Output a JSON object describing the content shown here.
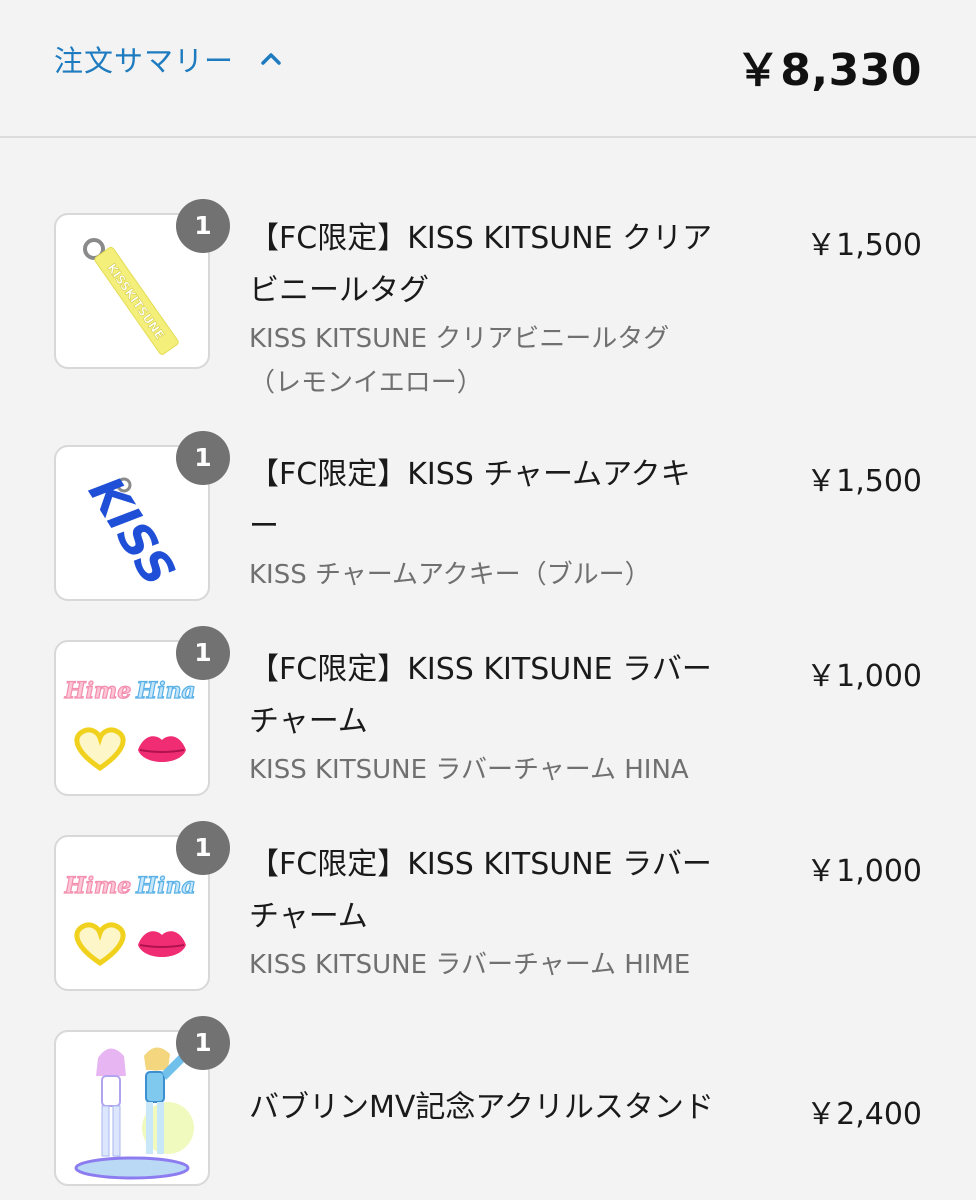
{
  "header": {
    "summary_label": "注文サマリー",
    "total": "￥8,330"
  },
  "items": [
    {
      "quantity": "1",
      "title_line1": "【FC限定】KISS KITSUNE クリア",
      "title_line2": "ビニールタグ",
      "variant_line1": "KISS KITSUNE クリアビニールタグ",
      "variant_line2": "（レモンイエロー）",
      "price": "￥1,500",
      "image_text": "KISSKITSUNE"
    },
    {
      "quantity": "1",
      "title_line1": "【FC限定】KISS チャームアクキ",
      "title_line2": "ー",
      "variant_line1": "KISS チャームアクキー（ブルー）",
      "price": "￥1,500",
      "image_text": "KISS"
    },
    {
      "quantity": "1",
      "title_line1": "【FC限定】KISS KITSUNE ラバー",
      "title_line2": "チャーム",
      "variant_line1": "KISS KITSUNE ラバーチャーム HINA",
      "price": "￥1,000",
      "image_text_1": "Hime",
      "image_text_2": "Hina"
    },
    {
      "quantity": "1",
      "title_line1": "【FC限定】KISS KITSUNE ラバー",
      "title_line2": "チャーム",
      "variant_line1": "KISS KITSUNE ラバーチャーム HIME",
      "price": "￥1,000",
      "image_text_1": "Hime",
      "image_text_2": "Hina"
    },
    {
      "quantity": "1",
      "title_line1": "バブリンMV記念アクリルスタンド",
      "price": "￥2,400"
    }
  ],
  "colors": {
    "link_blue": "#1f7bbf",
    "badge_gray": "#727272",
    "tag_yellow": "#f4ef7a",
    "charm_blue": "#1f4fd6"
  }
}
